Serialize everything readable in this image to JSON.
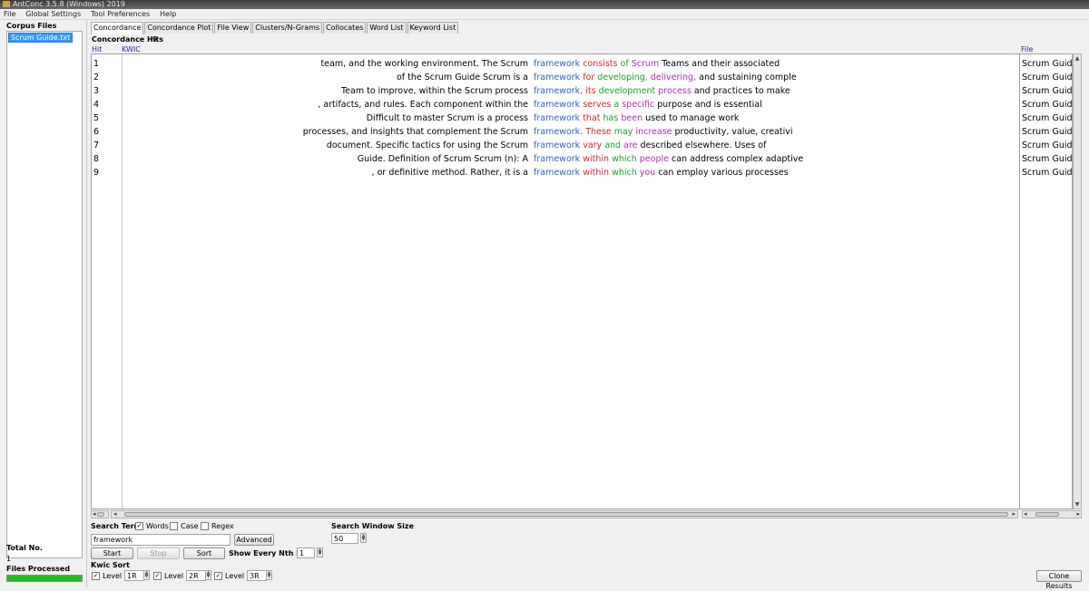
{
  "window": {
    "title": "AntConc 3.5.8 (Windows) 2019"
  },
  "menu": [
    "File",
    "Global Settings",
    "Tool Preferences",
    "Help"
  ],
  "sidebar": {
    "corpus_files_label": "Corpus Files",
    "files": [
      "Scrum Guide.txt"
    ],
    "total_no_label": "Total No.",
    "total_no_value": "1",
    "files_processed_label": "Files Processed",
    "files_processed_progress": 1.0
  },
  "tabs": [
    "Concordance",
    "Concordance Plot",
    "File View",
    "Clusters/N-Grams",
    "Collocates",
    "Word List",
    "Keyword List"
  ],
  "concordance": {
    "hits_label": "Concordance Hits",
    "hits_value": "9",
    "col_hit": "Hit",
    "col_kwic": "KWIC",
    "col_file": "File",
    "rows": [
      {
        "hit": "1",
        "left": "team, and the working environment.  The Scrum",
        "kw": "framework",
        "r1": "consists",
        "r2": "of",
        "r3": "Scrum",
        "rest": "Teams and their associated",
        "file": "Scrum Guide"
      },
      {
        "hit": "2",
        "left": "of the Scrum Guide Scrum is a",
        "kw": "framework",
        "r1": "for",
        "r2": "developing,",
        "r3": "delivering,",
        "rest": "and sustaining comple",
        "file": "Scrum Guide"
      },
      {
        "hit": "3",
        "left": "Team to improve, within the Scrum process",
        "kw": "framework,",
        "r1": "its",
        "r2": "development",
        "r3": "process",
        "rest": "and practices to make",
        "file": "Scrum Guide"
      },
      {
        "hit": "4",
        "left": ", artifacts, and rules. Each component within the",
        "kw": "framework",
        "r1": "serves",
        "r2": "a",
        "r3": "specific",
        "rest": "purpose and is essential",
        "file": "Scrum Guide"
      },
      {
        "hit": "5",
        "left": "Difficult to master Scrum is a process",
        "kw": "framework",
        "r1": "that",
        "r2": "has",
        "r3": "been",
        "rest": "used to manage work",
        "file": "Scrum Guide"
      },
      {
        "hit": "6",
        "left": "processes, and insights that complement the Scrum",
        "kw": "framework.",
        "r1": "These",
        "r2": "may",
        "r3": "increase",
        "rest": "productivity, value, creativi",
        "file": "Scrum Guide"
      },
      {
        "hit": "7",
        "left": "document.  Specific tactics for using the Scrum",
        "kw": "framework",
        "r1": "vary",
        "r2": "and",
        "r3": "are",
        "rest": "described elsewhere.  Uses of",
        "file": "Scrum Guide"
      },
      {
        "hit": "8",
        "left": "Guide.  Definition of Scrum Scrum (n): A",
        "kw": "framework",
        "r1": "within",
        "r2": "which",
        "r3": "people",
        "rest": "can address complex adaptive",
        "file": "Scrum Guide"
      },
      {
        "hit": "9",
        "left": ", or definitive method. Rather, it is a",
        "kw": "framework",
        "r1": "within",
        "r2": "which",
        "r3": "you",
        "rest": "can employ various processes",
        "file": "Scrum Guide"
      }
    ]
  },
  "controls": {
    "search_term_label": "Search Term",
    "words_label": "Words",
    "words_checked": true,
    "case_label": "Case",
    "case_checked": false,
    "regex_label": "Regex",
    "regex_checked": false,
    "search_value": "framework",
    "advanced_label": "Advanced",
    "start_label": "Start",
    "stop_label": "Stop",
    "sort_label": "Sort",
    "window_size_label": "Search Window Size",
    "window_size_value": "50",
    "nth_row_label": "Show Every Nth Row",
    "nth_row_value": "1",
    "kwic_sort_label": "Kwic Sort",
    "level1_label": "Level 1",
    "level1_value": "1R",
    "level2_label": "Level 2",
    "level2_value": "2R",
    "level3_label": "Level 3",
    "level3_value": "3R",
    "clone_label": "Clone Results"
  },
  "colors": {
    "keyword": "#2e62d0",
    "r1": "#e0252a",
    "r2": "#1fa025",
    "r3": "#b92ab9",
    "progress": "#18c218",
    "selection": "#3399ff"
  }
}
